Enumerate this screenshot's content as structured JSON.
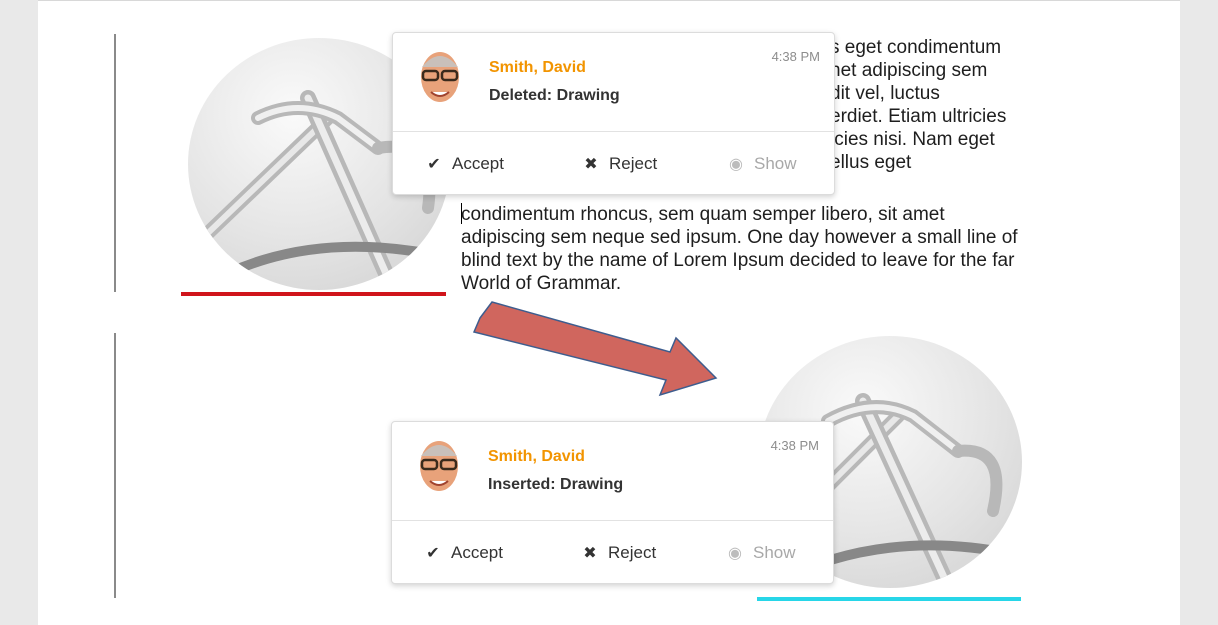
{
  "document": {
    "paragraph_main": "condimentum rhoncus, sem quam semper libero, sit amet adipiscing sem neque sed ipsum. One day however a small line of blind text by the name of Lorem Ipsum decided to leave for the far World of Grammar.",
    "paragraph_partial_lines": [
      "s eget condimentum",
      "net adipiscing sem",
      "dit vel, luctus",
      "erdiet. Etiam ultricies",
      "icies nisi. Nam eget",
      "ellus eget"
    ]
  },
  "cards": [
    {
      "author": "Smith, David",
      "action": "Deleted: Drawing",
      "time": "4:38 PM",
      "accept_label": "Accept",
      "reject_label": "Reject",
      "show_label": "Show"
    },
    {
      "author": "Smith, David",
      "action": "Inserted: Drawing",
      "time": "4:38 PM",
      "accept_label": "Accept",
      "reject_label": "Reject",
      "show_label": "Show"
    }
  ],
  "icons": {
    "accept": "checkmark-icon",
    "reject": "x-icon",
    "show": "eye-icon",
    "annotation": "arrow-icon"
  },
  "colors": {
    "author": "#f29400",
    "deleted_underline": "#d0141b",
    "inserted_underline": "#27d6e8",
    "arrow_fill": "#d0665e",
    "arrow_stroke": "#3e5d8e"
  }
}
